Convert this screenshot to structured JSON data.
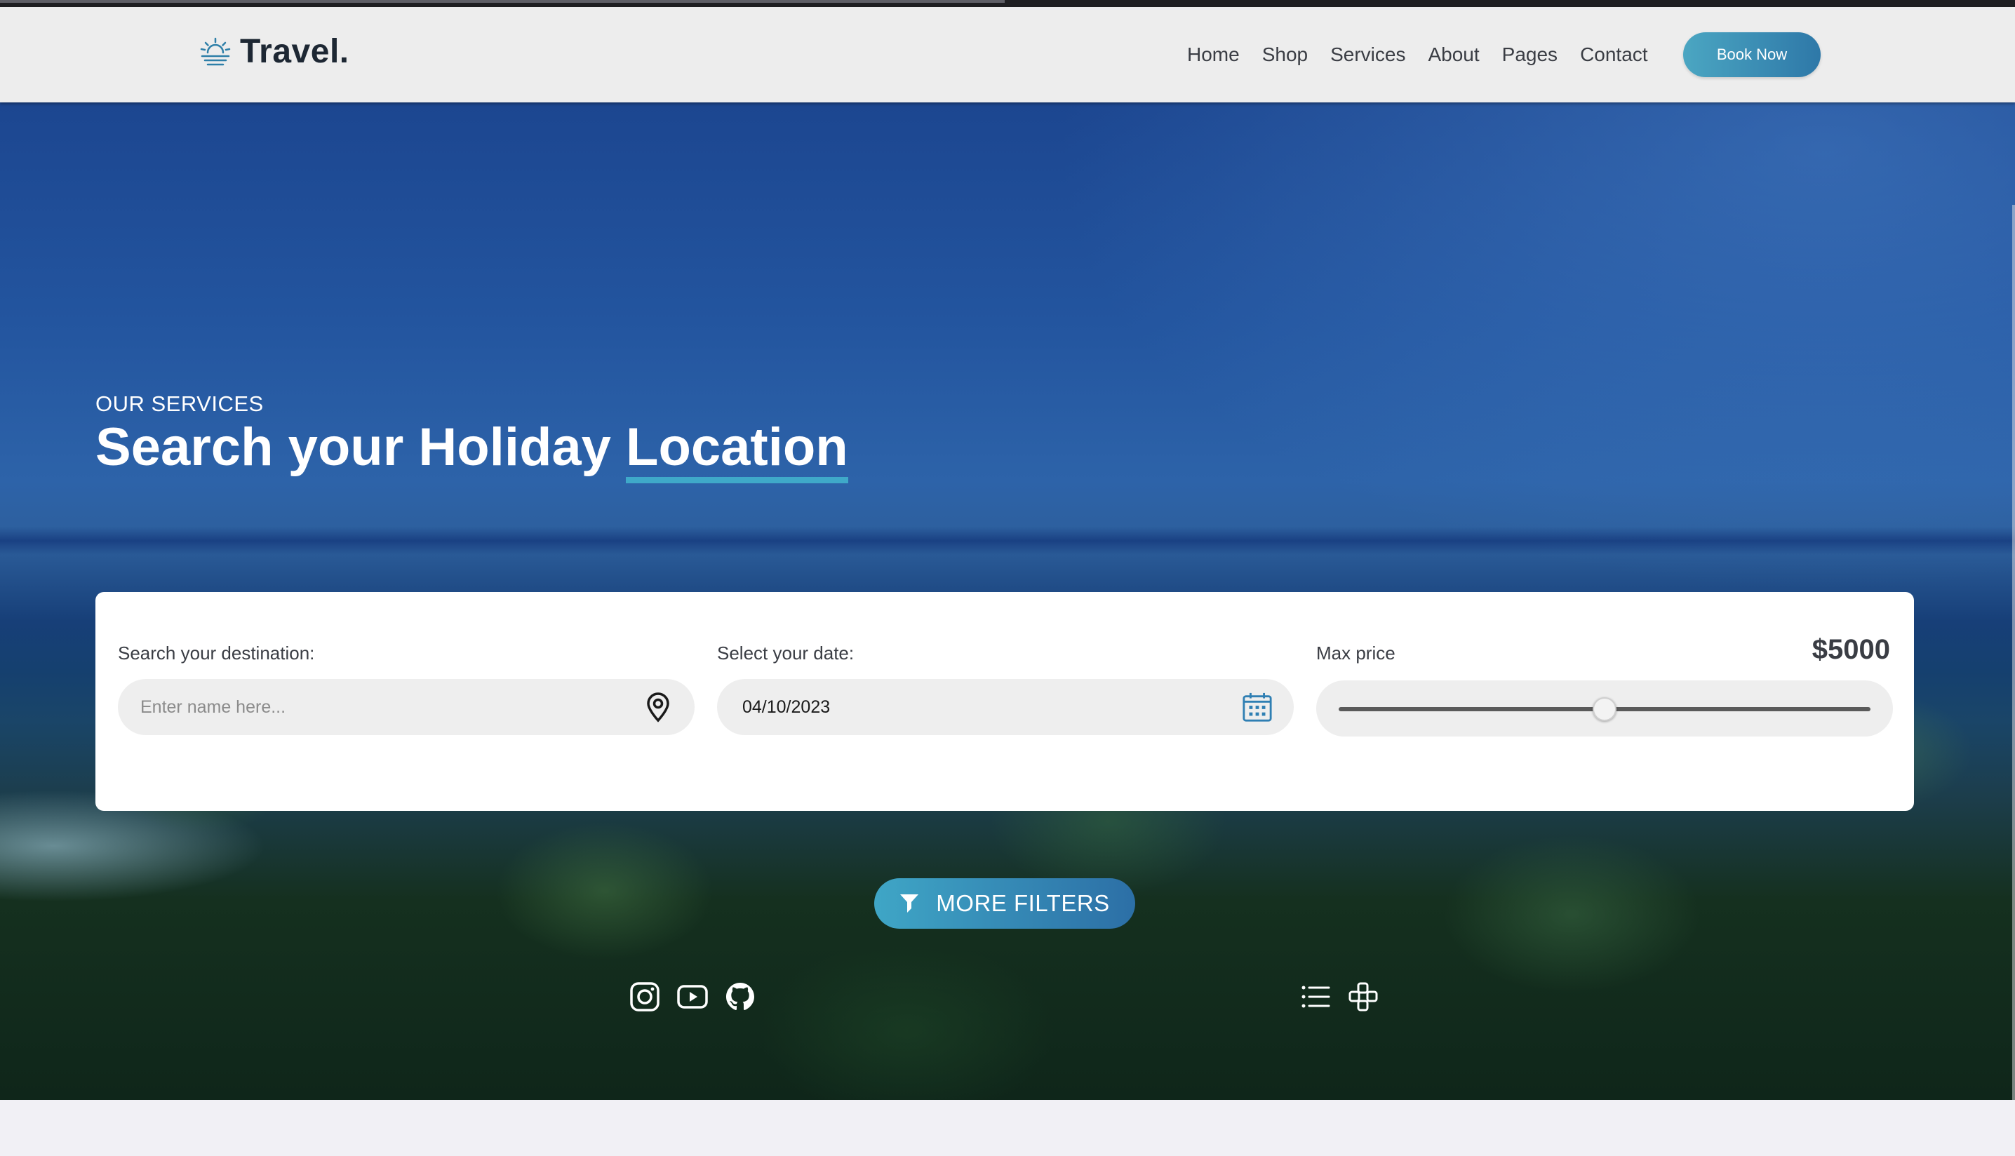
{
  "header": {
    "logo_text": "Travel.",
    "nav": [
      "Home",
      "Shop",
      "Services",
      "About",
      "Pages",
      "Contact"
    ],
    "book_label": "Book Now"
  },
  "hero": {
    "eyebrow": "OUR SERVICES",
    "title_main": "Search your Holiday ",
    "title_highlight": "Location"
  },
  "search": {
    "destination_label": "Search your destination:",
    "destination_placeholder": "Enter name here...",
    "destination_icon": "location-pin-icon",
    "date_label": "Select your date:",
    "date_value": "04/10/2023",
    "date_icon": "calendar-icon",
    "price_label": "Max price",
    "price_value": "$5000",
    "price_slider_fraction": 0.5,
    "filters_label": "MORE FILTERS",
    "filters_icon": "filter-icon"
  },
  "social_icons": [
    "instagram-icon",
    "youtube-icon",
    "github-icon"
  ],
  "tool_icons": [
    "list-icon",
    "grid-icon"
  ],
  "colors": {
    "accent_start": "#4ba6c2",
    "accent_end": "#2e78a8",
    "underline": "#3fa9c9",
    "text_dark": "#1d2733"
  }
}
